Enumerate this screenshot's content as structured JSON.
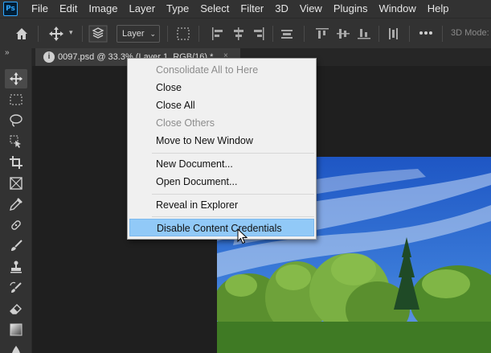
{
  "app": {
    "logo_text": "Ps"
  },
  "menubar": {
    "items": [
      "File",
      "Edit",
      "Image",
      "Layer",
      "Type",
      "Select",
      "Filter",
      "3D",
      "View",
      "Plugins",
      "Window",
      "Help"
    ]
  },
  "options_bar": {
    "layer_select_value": "Layer",
    "mode_label": "3D Mode:"
  },
  "document_tab": {
    "title": "0097.psd @ 33.3% (Layer 1, RGB/16) *",
    "close_glyph": "×"
  },
  "context_menu": {
    "items": [
      {
        "label": "Consolidate All to Here",
        "enabled": false
      },
      {
        "label": "Close",
        "enabled": true
      },
      {
        "label": "Close All",
        "enabled": true
      },
      {
        "label": "Close Others",
        "enabled": false
      },
      {
        "label": "Move to New Window",
        "enabled": true
      },
      {
        "label": "New Document...",
        "enabled": true
      },
      {
        "label": "Open Document...",
        "enabled": true
      },
      {
        "label": "Reveal in Explorer",
        "enabled": true
      },
      {
        "label": "Disable Content Credentials",
        "enabled": true,
        "highlighted": true
      }
    ]
  },
  "colors": {
    "menubar_bg": "#323232",
    "canvas_bg": "#1f1f1f",
    "menu_bg": "#f0f0f0",
    "menu_highlight": "#91c9f7",
    "ps_blue": "#31a8ff"
  }
}
